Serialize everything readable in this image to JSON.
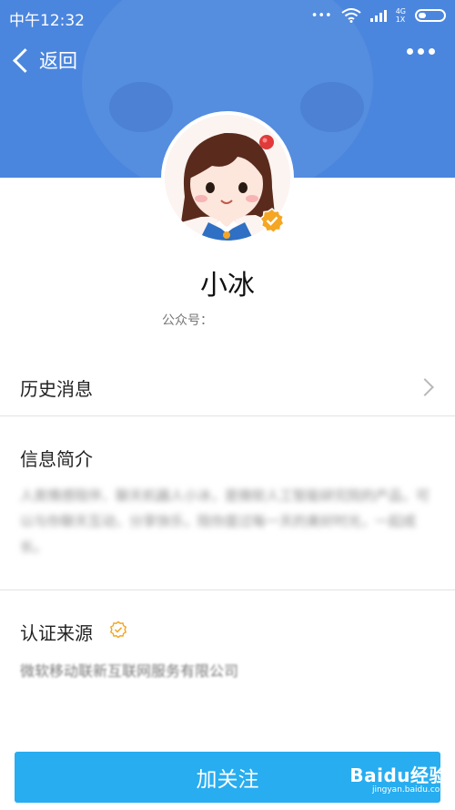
{
  "status_bar": {
    "time": "中午12:32",
    "network": "4G",
    "signal_sub": "1X"
  },
  "nav": {
    "back_label": "返回",
    "more_icon": "more-dots-icon"
  },
  "profile": {
    "name": "小冰",
    "account_label": "公众号：",
    "avatar_icon": "avatar-girl",
    "verified_icon": "verified-badge-icon"
  },
  "history": {
    "label": "历史消息"
  },
  "intro": {
    "title": "信息简介",
    "text": "人类情感陪伴、聊天机器人小冰，是微软人工智能研究院的产品，可以与你聊天互动，分享快乐，陪你度过每一天的美好时光，一起成长。"
  },
  "certification": {
    "title": "认证来源",
    "org": "微软移动联新互联网服务有限公司"
  },
  "footer": {
    "follow_label": "加关注",
    "watermark_main": "Baidu经验",
    "watermark_sub": "jingyan.baidu.com"
  },
  "colors": {
    "header_bg": "#4b86de",
    "button_bg": "#27adf0",
    "badge": "#f5a623"
  }
}
